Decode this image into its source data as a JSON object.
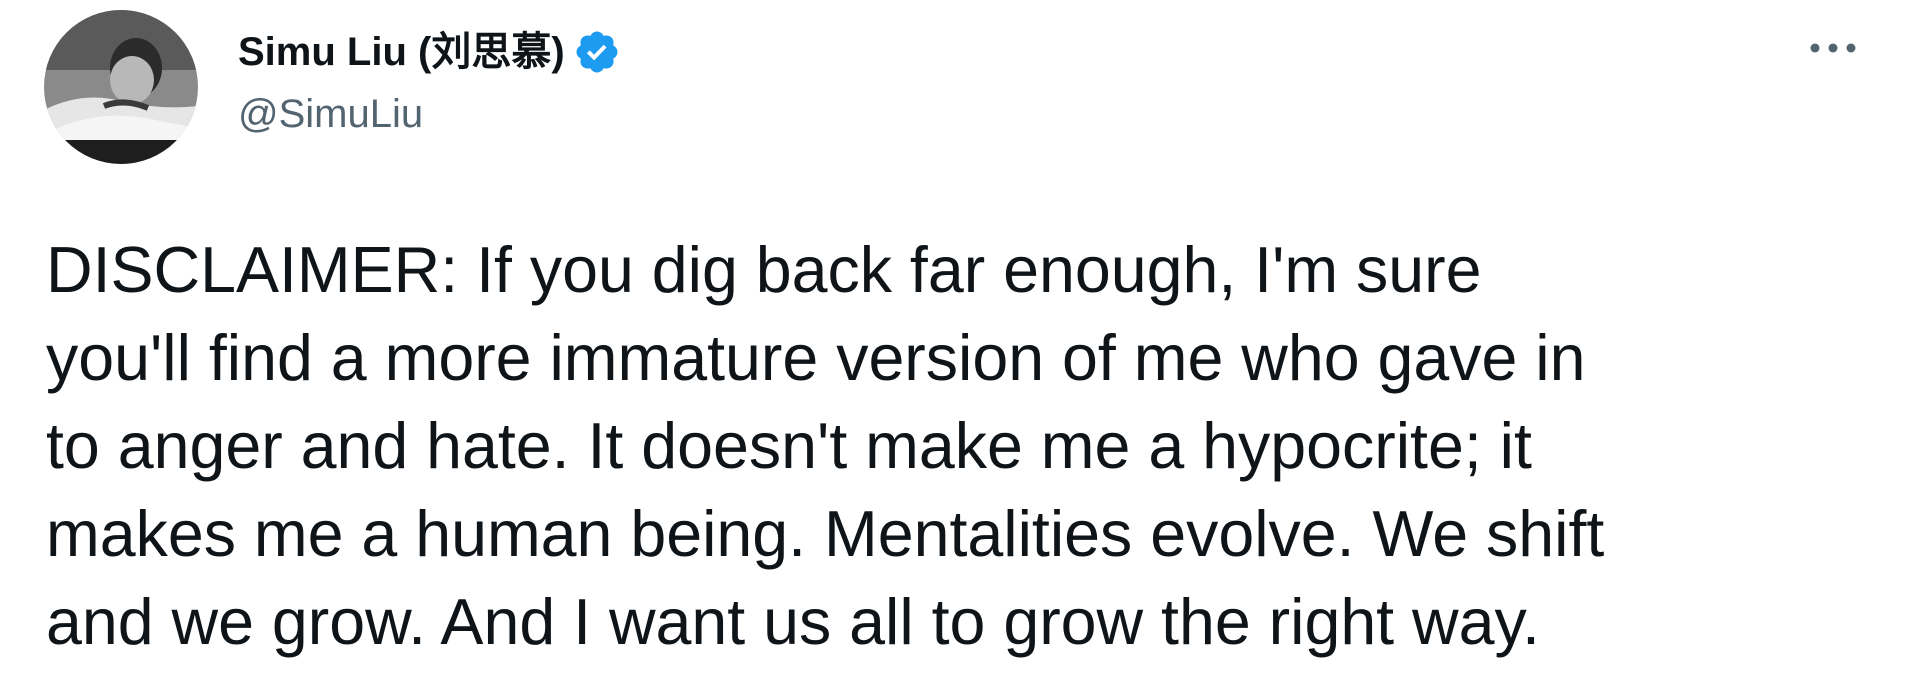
{
  "author": {
    "display_name": "Simu Liu (刘思慕)",
    "handle": "@SimuLiu",
    "verified": true,
    "avatar_icon": "user-photo-avatar"
  },
  "menu": {
    "icon": "more-options-icon"
  },
  "tweet": {
    "text": "DISCLAIMER: If you dig back far enough, I'm sure\nyou'll find a more immature version of me who gave in\nto anger and hate. It doesn't make me a hypocrite; it\nmakes me a human being. Mentalities evolve. We shift\nand we grow. And I want us all to grow the right way."
  },
  "colors": {
    "text": "#0f1419",
    "secondary": "#536471",
    "verified_badge": "#1d9bf0"
  }
}
